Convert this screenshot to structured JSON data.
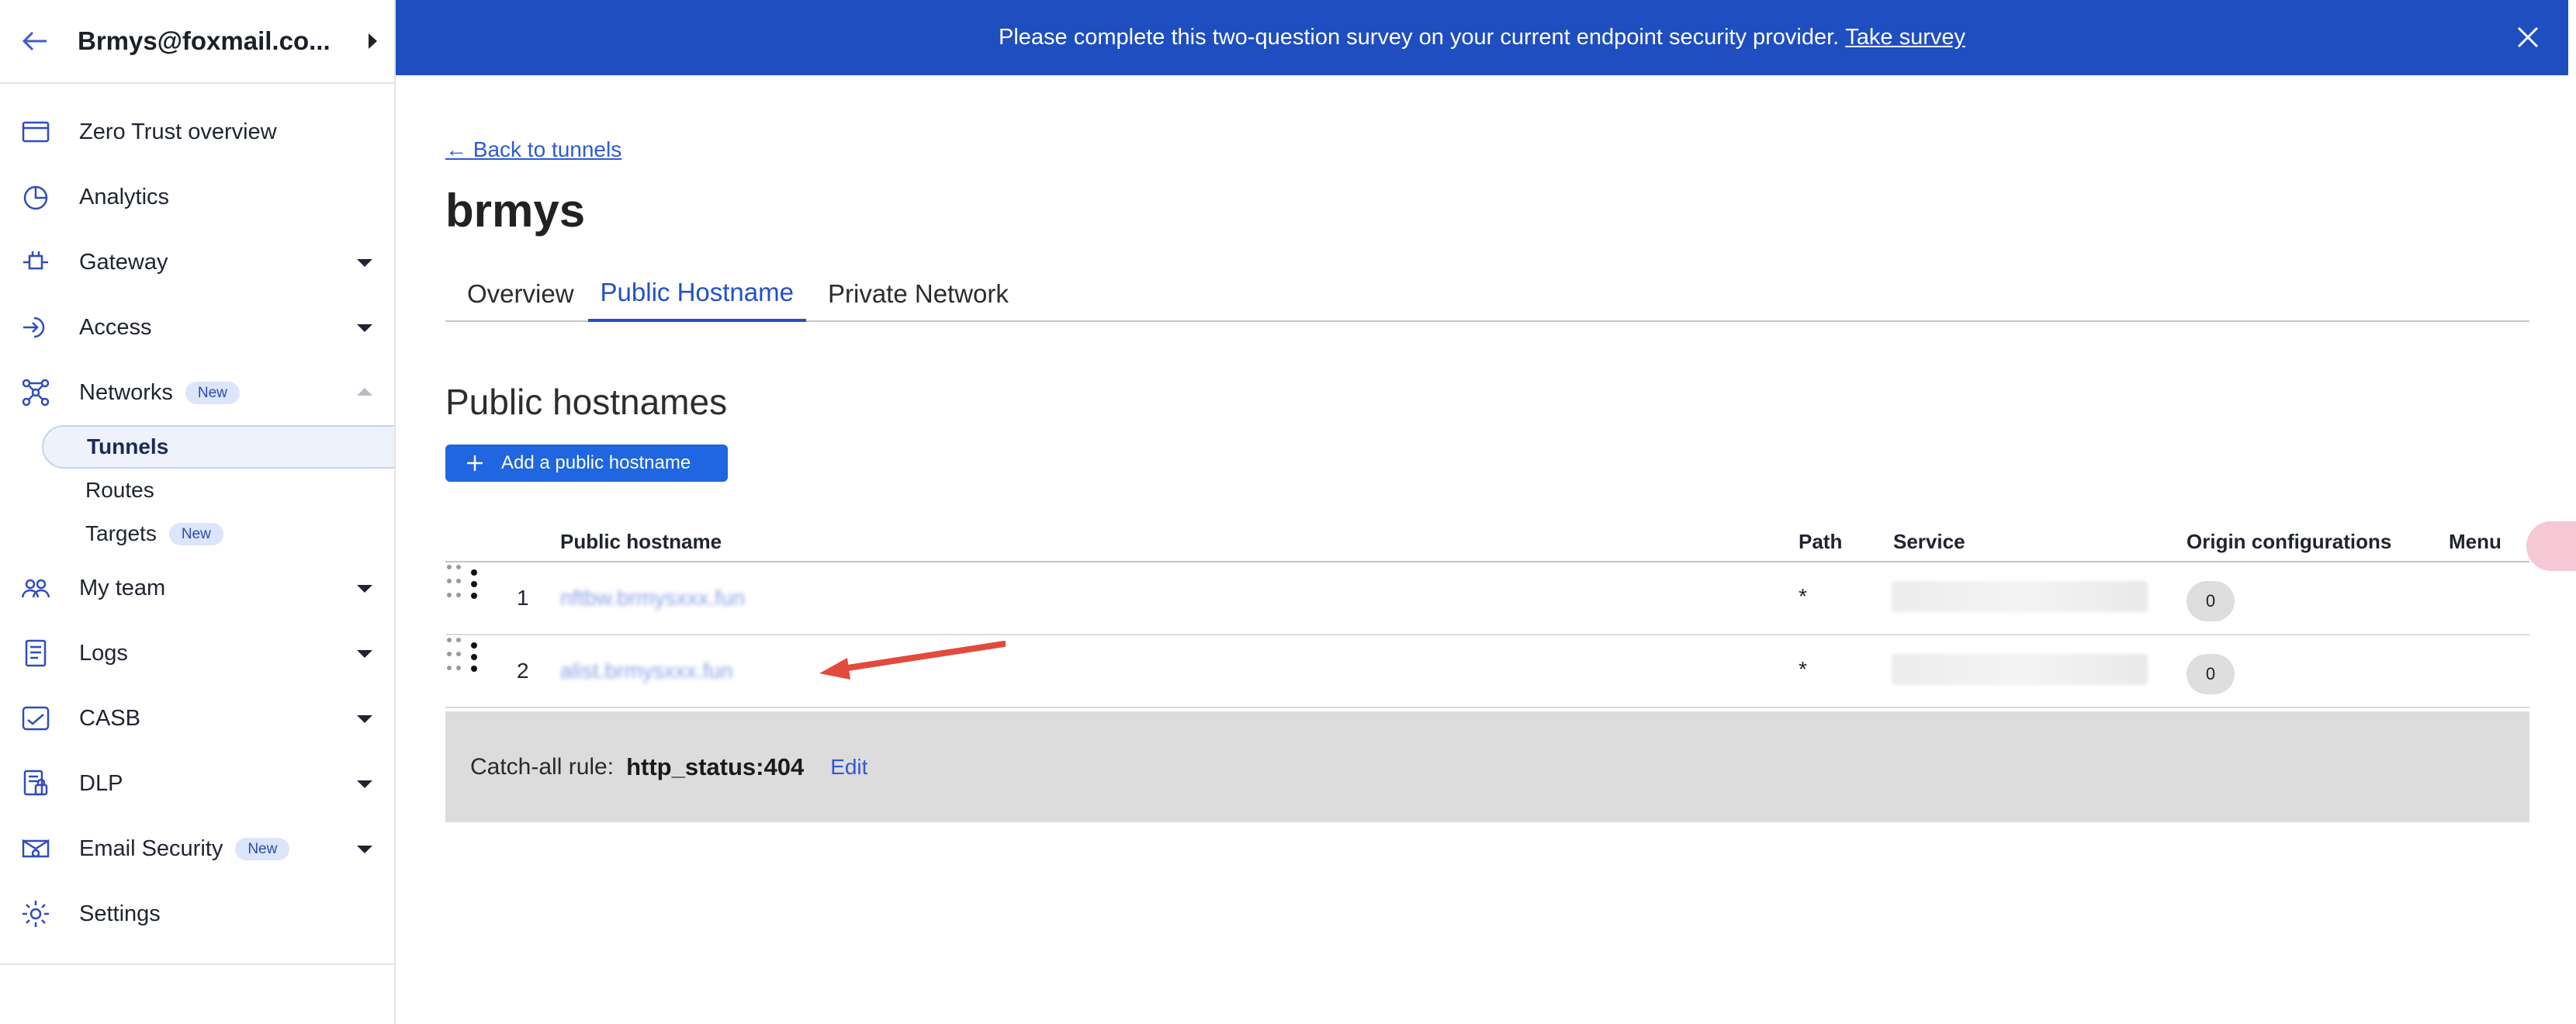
{
  "account": {
    "name": "Brmys@foxmail.co..."
  },
  "sidebar": {
    "items": [
      {
        "label": "Zero Trust overview",
        "icon": "browser-window-icon"
      },
      {
        "label": "Analytics",
        "icon": "pie-chart-icon"
      },
      {
        "label": "Gateway",
        "icon": "gateway-icon",
        "expandable": true
      },
      {
        "label": "Access",
        "icon": "access-icon",
        "expandable": true
      },
      {
        "label": "Networks",
        "icon": "network-icon",
        "badge": "New",
        "expanded": true
      },
      {
        "label": "My team",
        "icon": "team-icon",
        "expandable": true
      },
      {
        "label": "Logs",
        "icon": "logs-icon",
        "expandable": true
      },
      {
        "label": "CASB",
        "icon": "casb-icon",
        "expandable": true
      },
      {
        "label": "DLP",
        "icon": "dlp-icon",
        "expandable": true
      },
      {
        "label": "Email Security",
        "icon": "email-security-icon",
        "badge": "New",
        "expandable": true
      },
      {
        "label": "Settings",
        "icon": "gear-icon"
      }
    ],
    "networks_sub": [
      {
        "label": "Tunnels",
        "active": true
      },
      {
        "label": "Routes"
      },
      {
        "label": "Targets",
        "badge": "New"
      }
    ]
  },
  "banner": {
    "text": "Please complete this two-question survey on your current endpoint security provider.",
    "link": "Take survey",
    "color": "#1e4ec0"
  },
  "main": {
    "back_link": "← Back to tunnels",
    "title": "brmys",
    "tabs": [
      {
        "label": "Overview"
      },
      {
        "label": "Public Hostname",
        "active": true
      },
      {
        "label": "Private Network"
      }
    ],
    "section_title": "Public hostnames",
    "add_button": "Add a public hostname",
    "table": {
      "headers": {
        "hostname": "Public hostname",
        "path": "Path",
        "service": "Service",
        "origin": "Origin configurations",
        "menu": "Menu"
      },
      "rows": [
        {
          "num": "1",
          "hostname": "nftbw.brmysxxx.fun",
          "path": "*",
          "origin": "0"
        },
        {
          "num": "2",
          "hostname": "alist.brmysxxx.fun",
          "path": "*",
          "origin": "0"
        }
      ]
    },
    "catchall": {
      "label": "Catch-all rule:",
      "value": "http_status:404",
      "edit": "Edit"
    }
  },
  "colors": {
    "accent": "#2350c8",
    "button": "#1f66e0",
    "annotation_arrow": "#e24b3c"
  }
}
